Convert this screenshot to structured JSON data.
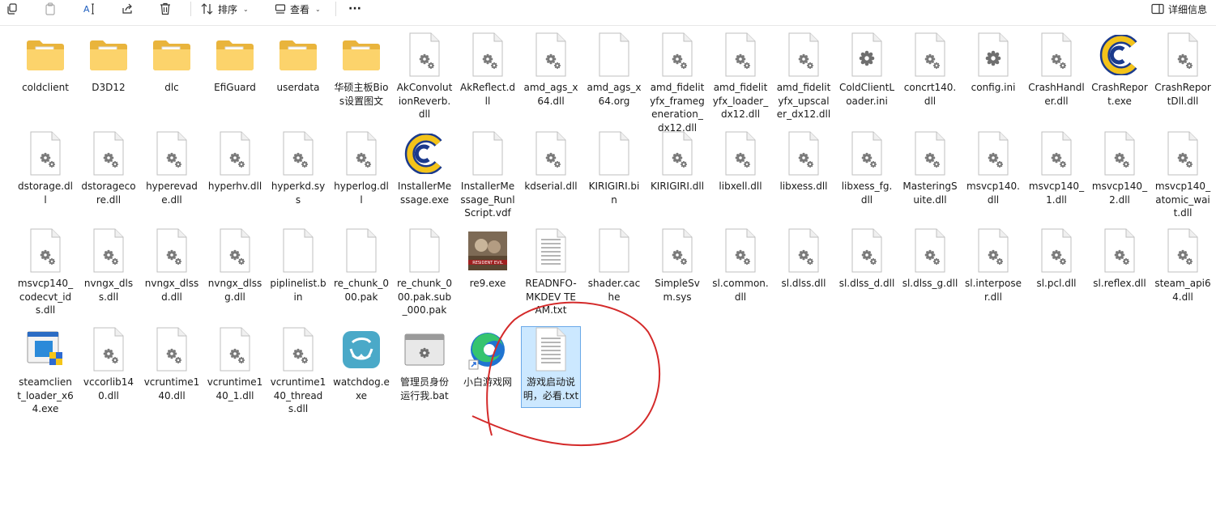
{
  "toolbar": {
    "sort_label": "排序",
    "view_label": "查看",
    "more_label": "···",
    "details_label": "详细信息"
  },
  "files": [
    {
      "name": "coldclient",
      "icon": "folder"
    },
    {
      "name": "D3D12",
      "icon": "folder"
    },
    {
      "name": "dlc",
      "icon": "folder"
    },
    {
      "name": "EfiGuard",
      "icon": "folder"
    },
    {
      "name": "userdata",
      "icon": "folder"
    },
    {
      "name": "华硕主板Bios设置图文",
      "icon": "folder"
    },
    {
      "name": "AkConvolutionReverb.dll",
      "icon": "dll"
    },
    {
      "name": "AkReflect.dll",
      "icon": "dll"
    },
    {
      "name": "amd_ags_x64.dll",
      "icon": "dll"
    },
    {
      "name": "amd_ags_x64.org",
      "icon": "blank"
    },
    {
      "name": "amd_fidelityfx_framegeneration_dx12.dll",
      "icon": "dll"
    },
    {
      "name": "amd_fidelityfx_loader_dx12.dll",
      "icon": "dll"
    },
    {
      "name": "amd_fidelityfx_upscaler_dx12.dll",
      "icon": "dll"
    },
    {
      "name": "ColdClientLoader.ini",
      "icon": "ini"
    },
    {
      "name": "concrt140.dll",
      "icon": "dll"
    },
    {
      "name": "config.ini",
      "icon": "ini"
    },
    {
      "name": "CrashHandler.dll",
      "icon": "dll"
    },
    {
      "name": "CrashReport.exe",
      "icon": "capcom"
    },
    {
      "name": "CrashReportDll.dll",
      "icon": "dll"
    },
    {
      "name": "dstorage.dll",
      "icon": "dll"
    },
    {
      "name": "dstoragecore.dll",
      "icon": "dll"
    },
    {
      "name": "hyperevade.dll",
      "icon": "dll"
    },
    {
      "name": "hyperhv.dll",
      "icon": "dll"
    },
    {
      "name": "hyperkd.sys",
      "icon": "dll"
    },
    {
      "name": "hyperlog.dll",
      "icon": "dll"
    },
    {
      "name": "InstallerMessage.exe",
      "icon": "capcom"
    },
    {
      "name": "InstallerMessage_RunlScript.vdf",
      "icon": "blank"
    },
    {
      "name": "kdserial.dll",
      "icon": "dll"
    },
    {
      "name": "KIRIGIRI.bin",
      "icon": "blank"
    },
    {
      "name": "KIRIGIRI.dll",
      "icon": "dll"
    },
    {
      "name": "libxell.dll",
      "icon": "dll"
    },
    {
      "name": "libxess.dll",
      "icon": "dll"
    },
    {
      "name": "libxess_fg.dll",
      "icon": "dll"
    },
    {
      "name": "MasteringSuite.dll",
      "icon": "dll"
    },
    {
      "name": "msvcp140.dll",
      "icon": "dll"
    },
    {
      "name": "msvcp140_1.dll",
      "icon": "dll"
    },
    {
      "name": "msvcp140_2.dll",
      "icon": "dll"
    },
    {
      "name": "msvcp140_atomic_wait.dll",
      "icon": "dll"
    },
    {
      "name": "msvcp140_codecvt_ids.dll",
      "icon": "dll"
    },
    {
      "name": "nvngx_dlss.dll",
      "icon": "dll"
    },
    {
      "name": "nvngx_dlssd.dll",
      "icon": "dll"
    },
    {
      "name": "nvngx_dlssg.dll",
      "icon": "dll"
    },
    {
      "name": "piplinelist.bin",
      "icon": "blank"
    },
    {
      "name": "re_chunk_000.pak",
      "icon": "blank"
    },
    {
      "name": "re_chunk_000.pak.sub_000.pak",
      "icon": "blank"
    },
    {
      "name": "re9.exe",
      "icon": "game"
    },
    {
      "name": "READNFO-MKDEV TEAM.txt",
      "icon": "txt"
    },
    {
      "name": "shader.cache",
      "icon": "blank"
    },
    {
      "name": "SimpleSvm.sys",
      "icon": "dll"
    },
    {
      "name": "sl.common.dll",
      "icon": "dll"
    },
    {
      "name": "sl.dlss.dll",
      "icon": "dll"
    },
    {
      "name": "sl.dlss_d.dll",
      "icon": "dll"
    },
    {
      "name": "sl.dlss_g.dll",
      "icon": "dll"
    },
    {
      "name": "sl.interposer.dll",
      "icon": "dll"
    },
    {
      "name": "sl.pcl.dll",
      "icon": "dll"
    },
    {
      "name": "sl.reflex.dll",
      "icon": "dll"
    },
    {
      "name": "steam_api64.dll",
      "icon": "dll"
    },
    {
      "name": "steamclient_loader_x64.exe",
      "icon": "installer"
    },
    {
      "name": "vccorlib140.dll",
      "icon": "dll"
    },
    {
      "name": "vcruntime140.dll",
      "icon": "dll"
    },
    {
      "name": "vcruntime140_1.dll",
      "icon": "dll"
    },
    {
      "name": "vcruntime140_threads.dll",
      "icon": "dll"
    },
    {
      "name": "watchdog.exe",
      "icon": "watchdog"
    },
    {
      "name": "管理员身份运行我.bat",
      "icon": "bat"
    },
    {
      "name": "小白游戏网",
      "icon": "edge"
    },
    {
      "name": "游戏启动说明，必看.txt",
      "icon": "txt",
      "selected": true
    }
  ]
}
